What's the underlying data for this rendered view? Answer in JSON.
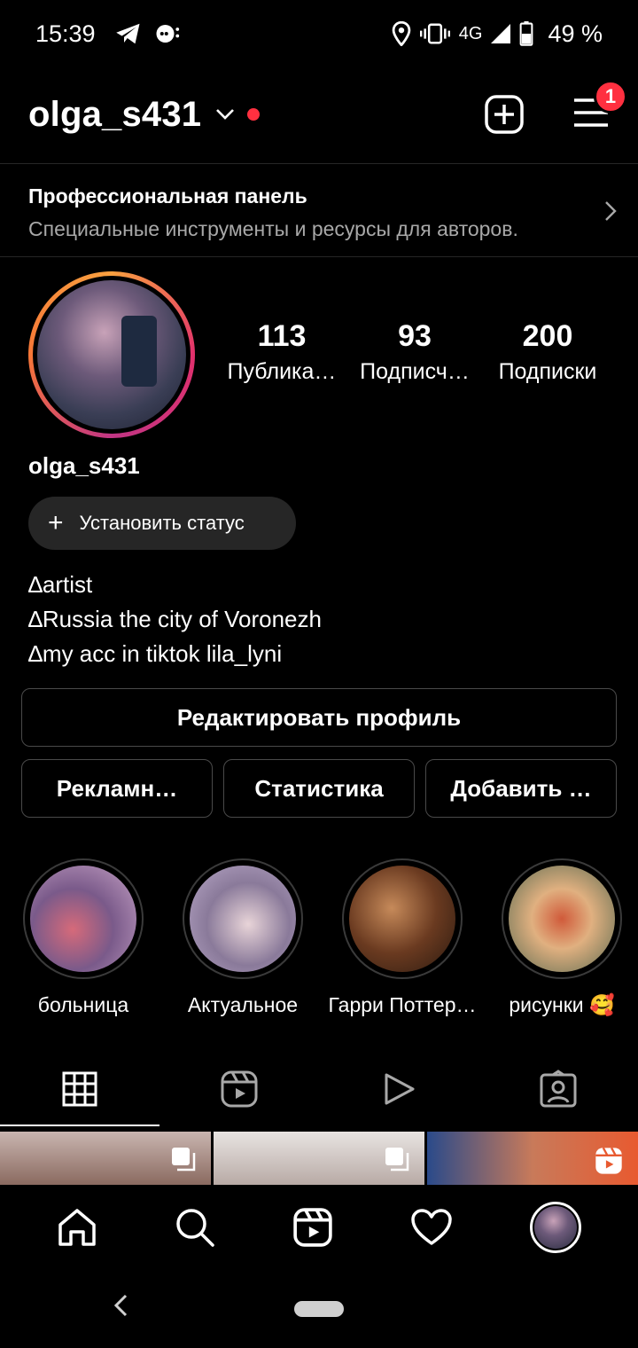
{
  "status_bar": {
    "time": "15:39",
    "network": "4G",
    "battery": "49 %"
  },
  "header": {
    "username": "olga_s431",
    "notification_count": "1"
  },
  "pro_panel": {
    "title": "Профессиональная панель",
    "subtitle": "Специальные инструменты и ресурсы для авторов."
  },
  "stats": [
    {
      "value": "113",
      "label": "Публика…"
    },
    {
      "value": "93",
      "label": "Подписч…"
    },
    {
      "value": "200",
      "label": "Подписки"
    }
  ],
  "profile": {
    "name": "olga_s431",
    "set_status": "Установить статус",
    "bio": [
      "∆artist",
      "∆Russia the city of Voronezh",
      "∆my acc in tiktok lila_lyni"
    ]
  },
  "buttons": {
    "edit_profile": "Редактировать профиль",
    "ads": "Рекламн…",
    "statistics": "Статистика",
    "add": "Добавить …"
  },
  "highlights": [
    {
      "label": "больница",
      "colors": [
        "#c7a3c6",
        "#7a5a8a",
        "#d66a7a"
      ]
    },
    {
      "label": "Актуальное",
      "colors": [
        "#b9a8c8",
        "#8a7a9a",
        "#e8d4d8"
      ]
    },
    {
      "label": "Гарри Поттер…",
      "colors": [
        "#c68a5a",
        "#6a3a20",
        "#2a1a10"
      ]
    },
    {
      "label": "рисунки 🥰",
      "colors": [
        "#e0b080",
        "#5a6a50",
        "#d05a3a"
      ]
    }
  ],
  "tabs": [
    "grid-icon",
    "reels-icon",
    "video-icon",
    "tagged-icon"
  ],
  "colors": {
    "accent": "#ff3040",
    "muted": "#a8a8a8",
    "border": "#4a4a4a",
    "pill": "#262626"
  }
}
